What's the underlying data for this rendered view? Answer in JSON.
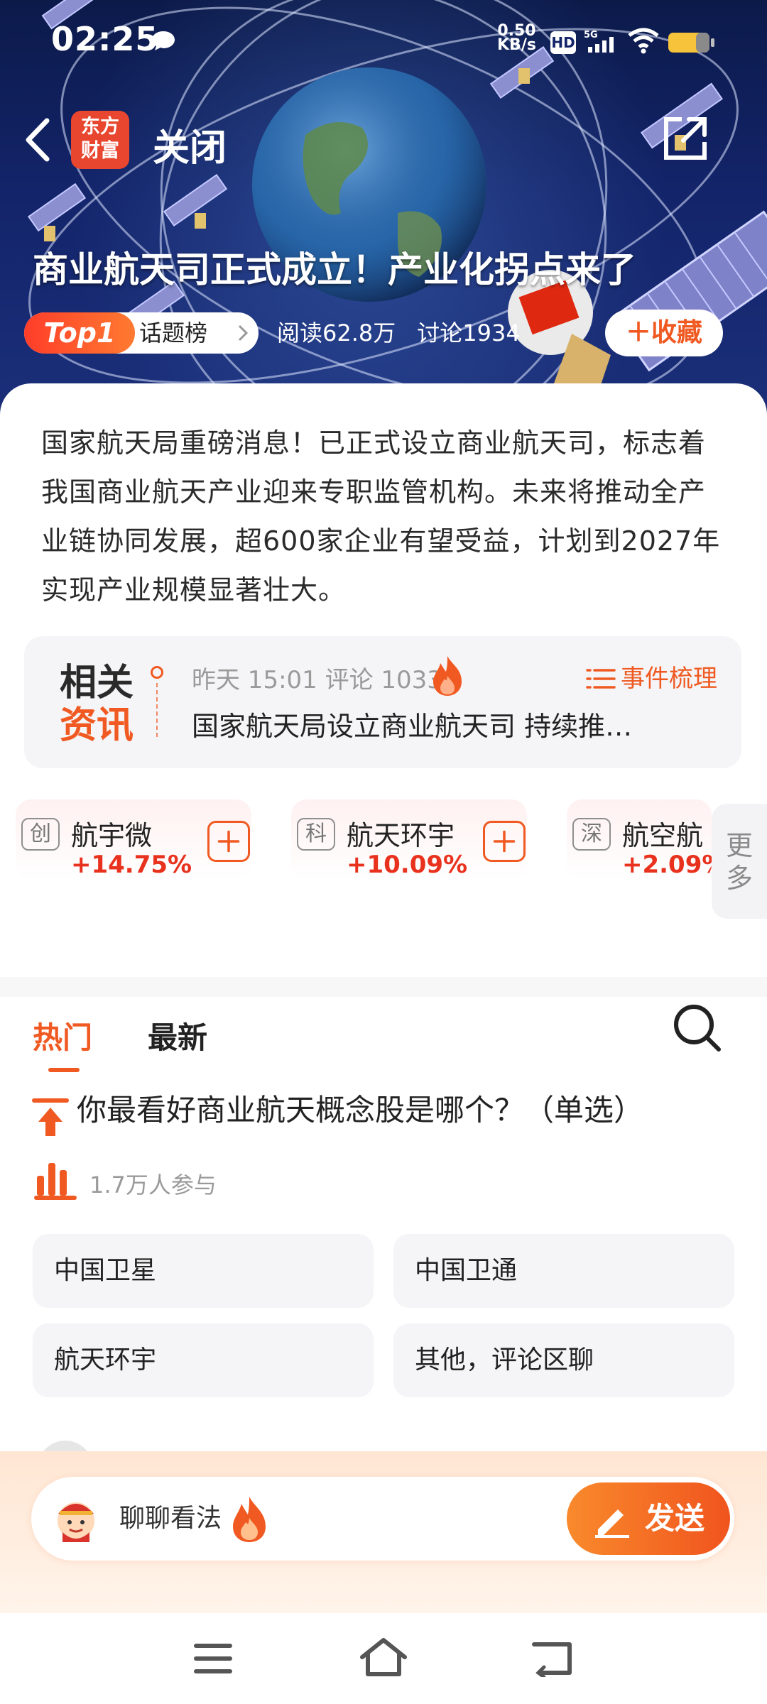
{
  "status_bar": {
    "time": "02:25",
    "net_speed_value": "0.50",
    "net_speed_unit": "KB/s",
    "hd": "HD",
    "signal": "5G"
  },
  "header": {
    "logo_line1": "东方",
    "logo_line2": "财富",
    "close_label": "关闭"
  },
  "topic": {
    "title": "商业航天司正式成立！产业化拐点来了",
    "rank_badge": "Top1",
    "rank_list": "话题榜",
    "reads": "阅读62.8万",
    "discussions": "讨论1934",
    "collect_label": "收藏",
    "description": "国家航天局重磅消息！已正式设立商业航天司，标志着我国商业航天产业迎来专职监管机构。未来将推动全产业链协同发展，超600家企业有望受益，计划到2027年实现产业规模显著壮大。"
  },
  "news": {
    "badge_line1": "相关",
    "badge_line2": "资讯",
    "meta": "昨天 15:01 评论 1033",
    "event_label": "事件梳理",
    "headline": "国家航天局设立商业航天司 持续推…"
  },
  "stocks": [
    {
      "market": "创",
      "name": "航宇微",
      "change": "+14.75%"
    },
    {
      "market": "科",
      "name": "航天环宇",
      "change": "+10.09%"
    },
    {
      "market": "深",
      "name": "航空航",
      "change": "+2.09%"
    }
  ],
  "more_label": "更多",
  "tabs": {
    "hot": "热门",
    "latest": "最新"
  },
  "poll": {
    "question": "你最看好商业航天概念股是哪个？（单选）",
    "participants": "1.7万人参与",
    "options": [
      "中国卫星",
      "中国卫通",
      "航天环宇",
      "其他，评论区聊"
    ]
  },
  "comment": {
    "placeholder": "聊聊看法",
    "send_label": "发送"
  },
  "colors": {
    "accent": "#f05a22",
    "rise": "#e8321e",
    "hero_bg": "#13246a"
  }
}
